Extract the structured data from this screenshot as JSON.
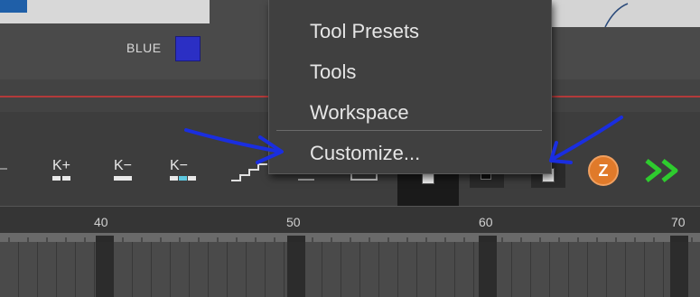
{
  "swatch": {
    "label": "BLUE",
    "color": "#2b2fc4"
  },
  "menu": {
    "items": [
      {
        "label": "Tool Presets"
      },
      {
        "label": "Tools"
      },
      {
        "label": "Workspace"
      },
      {
        "label": "Customize..."
      }
    ]
  },
  "toolbar": {
    "key_add_label": "K+",
    "key_remove_label": "K−",
    "key_tween_label": "K−",
    "zoom_label": "Z"
  },
  "ruler": {
    "ticks": [
      "40",
      "50",
      "60",
      "70"
    ]
  },
  "annotation_color": "#1a2ee0",
  "accent_orange": "#e07a2a",
  "accent_green": "#2ecc2e"
}
